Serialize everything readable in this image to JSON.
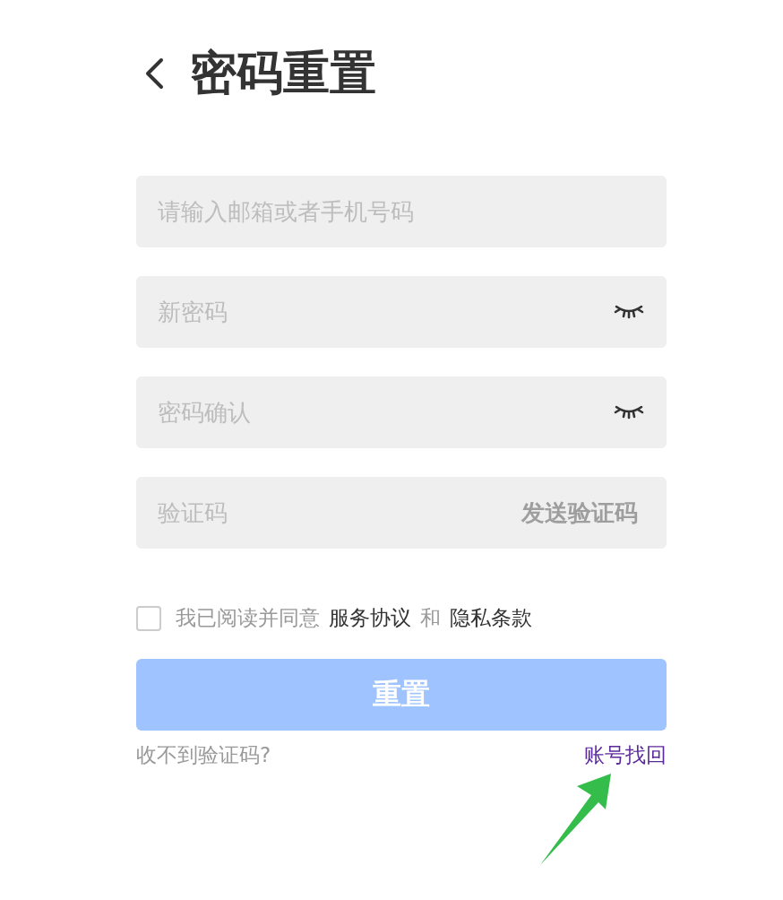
{
  "header": {
    "title": "密码重置"
  },
  "fields": [
    {
      "kind": "text",
      "placeholder": "请输入邮箱或者手机号码"
    },
    {
      "kind": "password",
      "placeholder": "新密码"
    },
    {
      "kind": "password",
      "placeholder": "密码确认"
    },
    {
      "kind": "code",
      "placeholder": "验证码",
      "action": "发送验证码"
    }
  ],
  "agreement": {
    "checked": false,
    "parts": [
      {
        "kind": "plain",
        "text": "我已阅读并同意"
      },
      {
        "kind": "link",
        "text": "服务协议"
      },
      {
        "kind": "plain",
        "text": "和"
      },
      {
        "kind": "link",
        "text": "隐私条款"
      }
    ]
  },
  "submit": {
    "label": "重置",
    "disabled": true
  },
  "footer": {
    "help": "收不到验证码?",
    "recover": "账号找回"
  }
}
